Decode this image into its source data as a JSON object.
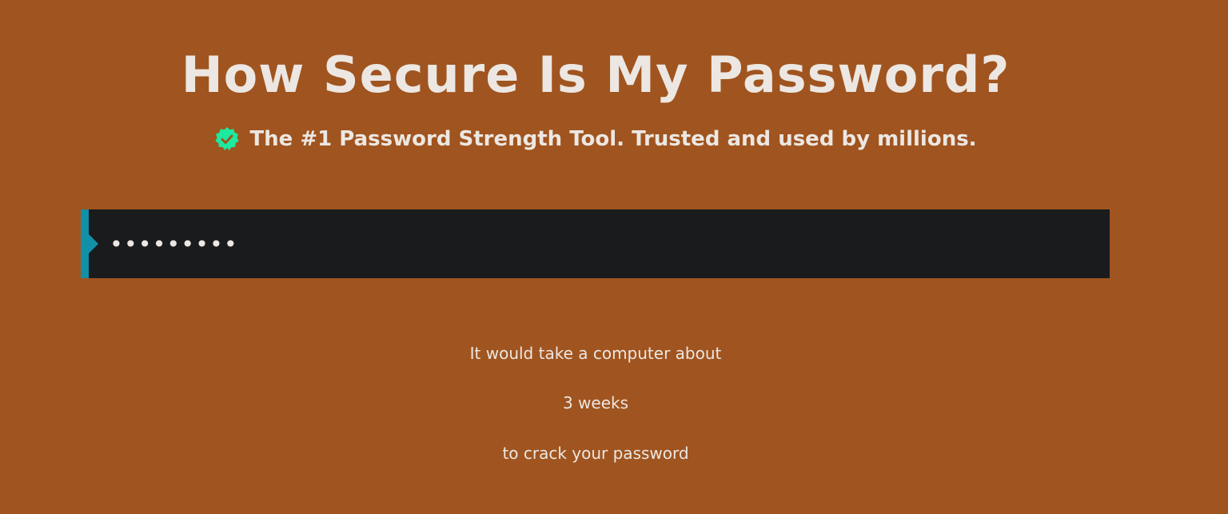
{
  "header": {
    "title": "How Secure Is My Password?",
    "tagline": "The #1 Password Strength Tool. Trusted and used by millions.",
    "tagline_icon": "verified-badge-icon"
  },
  "password_field": {
    "value": "•••••••••",
    "masked": true,
    "char_count": 9
  },
  "result": {
    "line1": "It would take a computer about",
    "time": "3 weeks",
    "line3": "to crack your password"
  },
  "colors": {
    "background": "#a0541f",
    "input_background": "#1a1b1d",
    "accent": "#1190a8",
    "badge": "#1de9a0",
    "text": "#ece7e2"
  }
}
